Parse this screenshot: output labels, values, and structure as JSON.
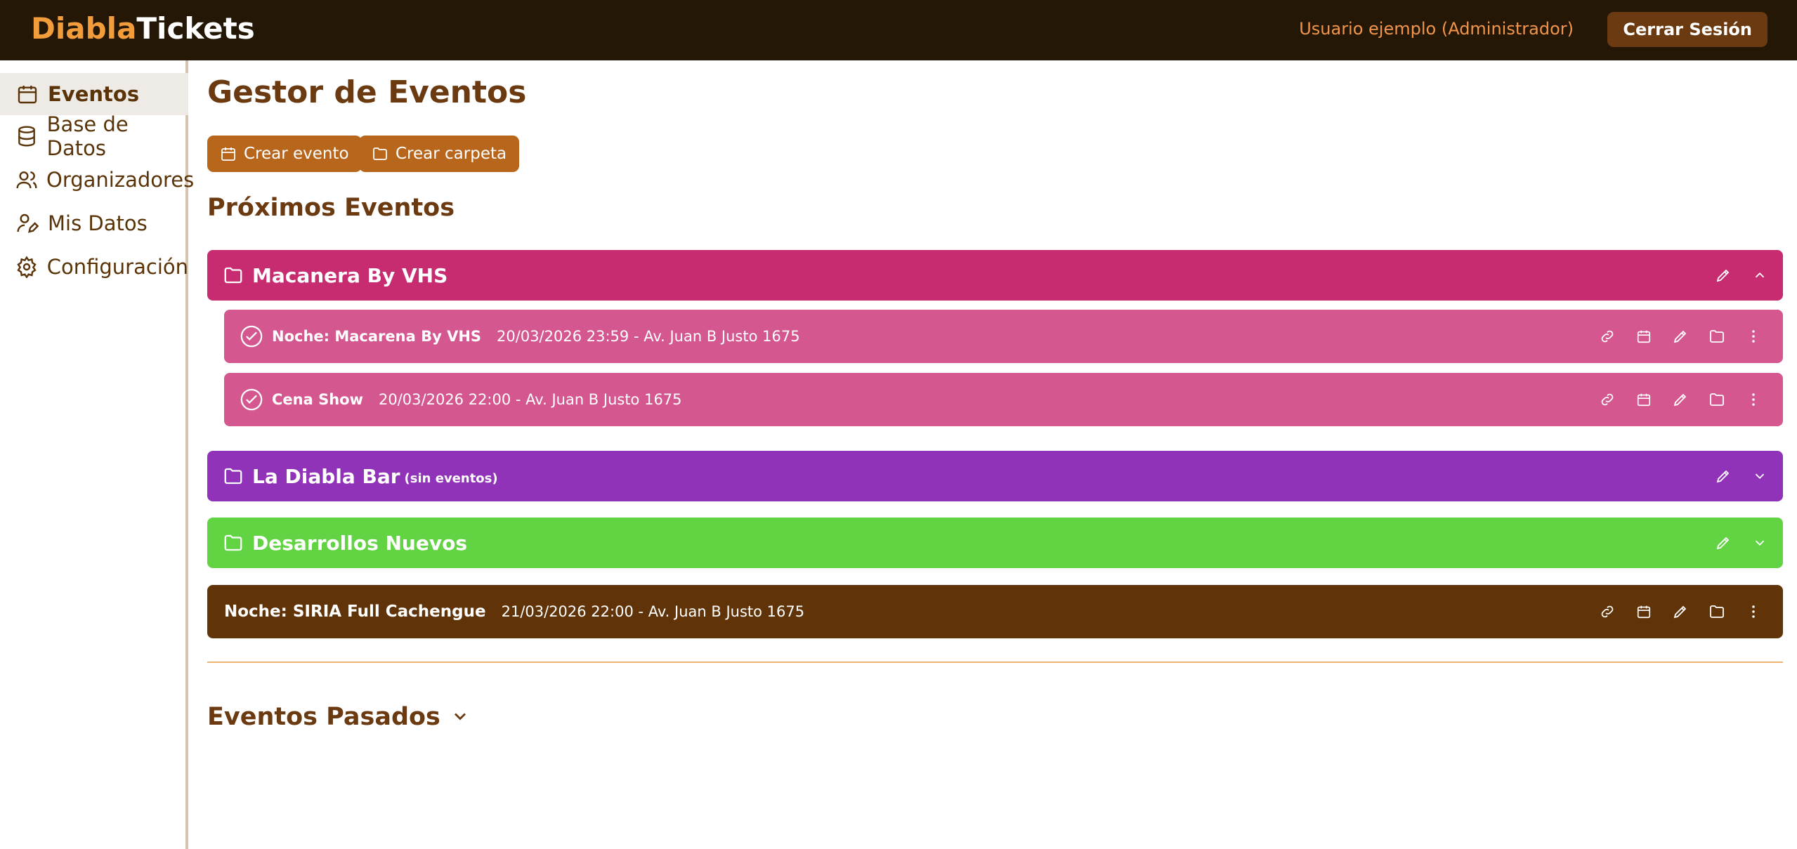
{
  "header": {
    "logo_part1": "Diabla",
    "logo_part2": "Tickets",
    "user_label": "Usuario ejemplo (Administrador)",
    "logout_label": "Cerrar Sesión"
  },
  "sidebar": {
    "items": [
      {
        "label": "Eventos",
        "icon": "calendar-icon",
        "active": true
      },
      {
        "label": "Base de Datos",
        "icon": "database-icon"
      },
      {
        "label": "Organizadores",
        "icon": "users-icon"
      },
      {
        "label": "Mis Datos",
        "icon": "user-edit-icon"
      },
      {
        "label": "Configuración",
        "icon": "gear-icon"
      }
    ]
  },
  "main": {
    "title": "Gestor de Eventos",
    "create_event_label": "Crear evento",
    "create_folder_label": "Crear carpeta",
    "upcoming_title": "Próximos Eventos",
    "past_title": "Eventos Pasados",
    "folders": [
      {
        "name": "Macanera By VHS",
        "note": "",
        "color": "#c72c70",
        "expanded": true,
        "events": [
          {
            "title": "Noche: Macarena By VHS",
            "meta": "20/03/2026 23:59 - Av. Juan B Justo 1675",
            "color": "#d4578f"
          },
          {
            "title": "Cena Show",
            "meta": "20/03/2026 22:00 - Av. Juan B Justo 1675",
            "color": "#d4578f"
          }
        ]
      },
      {
        "name": "La Diabla Bar",
        "note": "(sin eventos)",
        "color": "#9133b9",
        "expanded": false
      },
      {
        "name": "Desarrollos Nuevos",
        "note": "",
        "color": "#62d443",
        "expanded": false
      }
    ],
    "standalone_event": {
      "title": "Noche: SIRIA Full Cachengue",
      "meta": "21/03/2026 22:00 - Av. Juan B Justo 1675",
      "color": "#603408"
    }
  },
  "colors": {
    "header_bg": "#241706",
    "accent": "#b8661c",
    "text_brown": "#6b3a10",
    "logo_orange": "#f39c3c"
  }
}
